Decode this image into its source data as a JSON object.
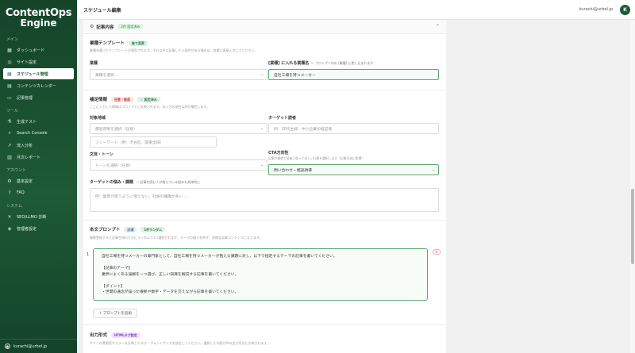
{
  "app": {
    "logo_line1": "ContentOps",
    "logo_line2": "Engine"
  },
  "header": {
    "title": "スケジュール編集",
    "user_email": "kurachi@urbel.jp",
    "avatar_initial": "K"
  },
  "sidebar": {
    "sections": [
      {
        "label": "メイン",
        "items": [
          {
            "label": "ダッシュボード",
            "icon": "grid-icon",
            "active": false
          },
          {
            "label": "サイト設定",
            "icon": "globe-icon",
            "active": false
          },
          {
            "label": "スケジュール管理",
            "icon": "calendar-icon",
            "active": true
          },
          {
            "label": "コンテンツカレンダー",
            "icon": "calendar-icon",
            "active": false
          },
          {
            "label": "記事管理",
            "icon": "document-icon",
            "active": false
          }
        ]
      },
      {
        "label": "ツール",
        "items": [
          {
            "label": "生成テスト",
            "icon": "flask-icon",
            "active": false
          },
          {
            "label": "Search Console",
            "icon": "search-icon",
            "active": false
          },
          {
            "label": "流入分析",
            "icon": "chart-icon",
            "active": false
          },
          {
            "label": "月次レポート",
            "icon": "report-icon",
            "active": false
          }
        ]
      },
      {
        "label": "アカウント",
        "items": [
          {
            "label": "基本設定",
            "icon": "gear-icon",
            "active": false
          },
          {
            "label": "FAQ",
            "icon": "help-icon",
            "active": false
          }
        ]
      },
      {
        "label": "システム",
        "items": [
          {
            "label": "SEO/LLMO 診断",
            "icon": "wrench-icon",
            "active": false
          },
          {
            "label": "管理者設定",
            "icon": "shield-icon",
            "active": false
          }
        ]
      }
    ],
    "footer_user": "kurachi@urbel.jp"
  },
  "section": {
    "title": "記事内容",
    "badge": "2件 設定済み"
  },
  "template": {
    "title": "業種テンプレート",
    "badge": "後で変更",
    "desc": "業種を選ぶとテンプレートが適用されます。それ以外に記事したい条件がある場合は、各欄に直接入力してください。",
    "industry_label": "業種",
    "industry_placeholder": "業種を選択...",
    "company_label": "[業種] に入れる業種名",
    "company_sub": "← プロンプト内の [業種] に差し込まれます",
    "company_value": "自社工場を持つメーカー"
  },
  "supplement": {
    "title": "補足情報",
    "badge_required": "任意・推奨",
    "badge_set": "✓ 設定済み",
    "desc": "ここに入力した情報はプロンプトに反映されます。未入力の項目はAIが補完します。",
    "target_region_label": "対象地域",
    "target_region_placeholder": "都道府県を選択（任意）",
    "free_word_placeholder": "フリーワード（例：渋谷区、関東全域）",
    "target_reader_label": "ターゲット読者",
    "target_reader_placeholder": "例：30代主婦、中小企業の経営者",
    "tone_label": "文体・トーン",
    "tone_placeholder": "トーンを選択（任意）",
    "cta_label": "CTA方向性",
    "cta_hint": "記事の最後で読者に取ってほしい行動を選択します（記事生成に影響）",
    "cta_value": "問い合わせ・相談誘導",
    "pain_label": "ターゲットの悩み・課題",
    "pain_sub": "— 記事を読む人が抱えている悩みを具体的に",
    "pain_placeholder": "例：集客が思うように増えない、社員の離職が多い..."
  },
  "prompt": {
    "title": "本文プロンプト",
    "badge_required": "必須",
    "badge_count": "1件ランダム",
    "desc": "複数登録すると記事生成のたびにランダムで1つ選択されます。テーマの偏りを防ぎ、多様な記事コンテンツになります。",
    "number": "1",
    "text": "自社工場を持つメーカーの専門家として、自社工場を持つメーカーが抱える課題に対し、以下で指定するテーマの記事を書いてください。\n\n【記事のテーマ】\n業界によくある誤解を一つ選び、正しい知識を解説する記事を書いてください。\n\n【ポイント】\n・世間の通念が誤った根拠や数字・データを交えながら記事を書いてください。",
    "remove_icon": "close-icon",
    "add_label": "＋ プロンプトを追加"
  },
  "output": {
    "title": "出力形式",
    "badge": "HTMLタグ設定",
    "desc": "サイトの雰囲気やカラーを反映したタグ・フォントサイズを設定してください。選択した内容がAIの出力形式に反映されます。"
  }
}
